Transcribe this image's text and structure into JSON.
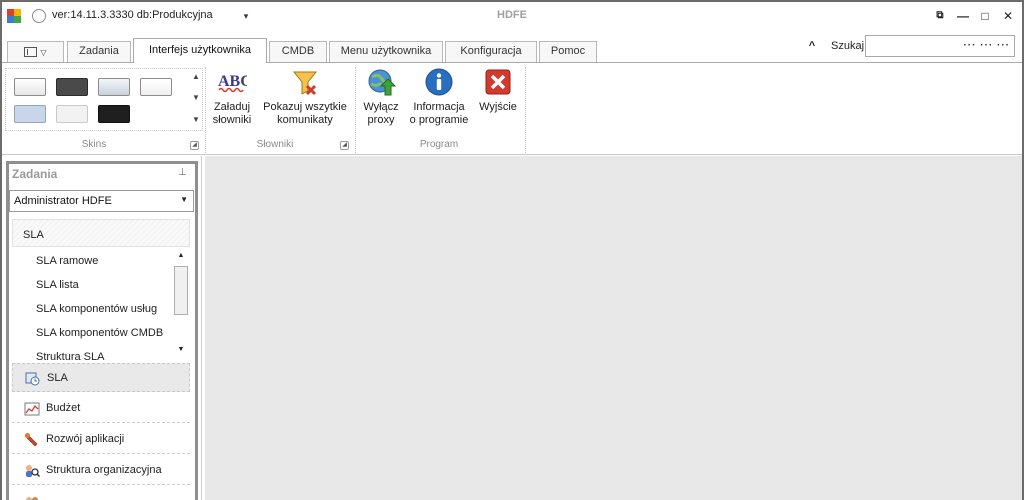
{
  "titlebar": {
    "version_text": "ver:14.11.3.3330 db:Produkcyjna",
    "title": "HDFE",
    "qat_dropdown_glyph": "▾",
    "controls": {
      "restore": "⧉",
      "minimize": "—",
      "maximize": "□",
      "close": "✕"
    }
  },
  "tabs": {
    "items": [
      {
        "label": "Zadania"
      },
      {
        "label": "Interfejs użytkownika"
      },
      {
        "label": "CMDB"
      },
      {
        "label": "Menu użytkownika"
      },
      {
        "label": "Konfiguracja"
      },
      {
        "label": "Pomoc"
      }
    ],
    "active": "Interfejs użytkownika"
  },
  "search": {
    "label": "Szukaj",
    "dots": "··· ··· ···",
    "collapse_glyph": "^"
  },
  "ribbon": {
    "groups": {
      "skins": {
        "label": "Skins"
      },
      "slowniki": {
        "label": "Słowniki",
        "load": {
          "line1": "Załaduj",
          "line2": "słowniki"
        },
        "show_all": {
          "line1": "Pokazuj wszytkie",
          "line2": "komunikaty"
        }
      },
      "program": {
        "label": "Program",
        "disable_proxy": {
          "line1": "Wyłącz",
          "line2": "proxy"
        },
        "info": {
          "line1": "Informacja",
          "line2": "o programie"
        },
        "exit": {
          "line1": "Wyjście"
        }
      }
    },
    "abc_text": "ABC"
  },
  "left_pane": {
    "title": "Zadania",
    "user_combo": "Administrator HDFE",
    "group_header": "SLA",
    "list_items": [
      "SLA ramowe",
      "SLA lista",
      "SLA komponentów usług",
      "SLA komponentów CMDB",
      "Struktura SLA"
    ],
    "nav_buttons": [
      {
        "label": "SLA",
        "icon": "sla-icon"
      },
      {
        "label": "Budżet",
        "icon": "chart-icon"
      },
      {
        "label": "Rozwój aplikacji",
        "icon": "wrench-icon"
      },
      {
        "label": "Struktura organizacyjna",
        "icon": "people-search-icon"
      }
    ]
  },
  "colors": {
    "frame": "#6b6b6b",
    "workspace": "#e8e8e8",
    "exit_red": "#d23a2e",
    "info_blue": "#2a6fbf",
    "proxy_green": "#3ea23a"
  }
}
